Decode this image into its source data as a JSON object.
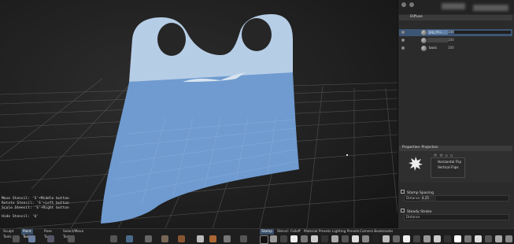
{
  "viewport": {
    "stencil_help": [
      "Move Stencil: 'S'+Middle button",
      "Rotate Stencil: 'S'+Left button",
      "Scale Stencil: 'S'+Right button"
    ],
    "hide_stencil": "Hide Stencil: 'Q'"
  },
  "layers": {
    "group_label": "Diffuse",
    "rows": [
      {
        "name": "jpg_dru...",
        "value": "100"
      },
      {
        "name": "",
        "value": "100"
      },
      {
        "name": "basic",
        "value": "100"
      }
    ]
  },
  "properties": {
    "header": "Properties: Projection",
    "menu_items": [
      "Horizontal Flip",
      "Vertical Flips"
    ],
    "stamp_spacing_label": "Stamp Spacing",
    "distance_label": "Distance",
    "distance_value": "4.25",
    "steady_stroke_label": "Steady Stroke"
  },
  "bottom": {
    "left_tabs": [
      "Sculpt Tools",
      "Paint Tools",
      "Pose Tools",
      "Select/Move Tools"
    ],
    "active_left_tab": "Paint Tools",
    "right_tabs": [
      "Stamp",
      "Stencil",
      "Falloff",
      "Material Presets",
      "Lighting Presets",
      "Camera Bookmarks"
    ],
    "active_right_tab": "Stamp"
  },
  "colors": {
    "fabric_light": "#b6cde6",
    "fabric_main": "#6f9bd0",
    "selection": "#3d5574",
    "active_tab": "#3a4f6a"
  }
}
